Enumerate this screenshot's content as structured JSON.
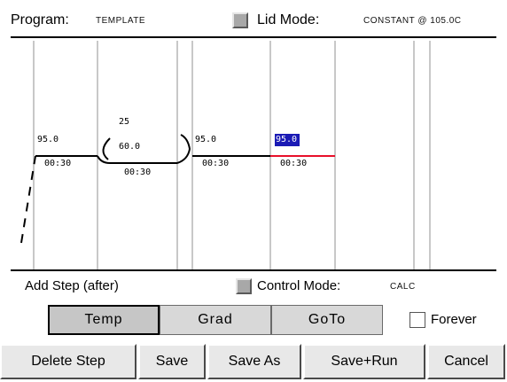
{
  "header": {
    "program_label": "Program:",
    "program_name": "TEMPLATE",
    "lid_mode_label": "Lid Mode:",
    "lid_mode_value": "CONSTANT @ 105.0C"
  },
  "steps": [
    {
      "temp": "95.0",
      "time": "00:30"
    },
    {
      "temp": "60.0",
      "time": "00:30",
      "goto": "25"
    },
    {
      "temp": "95.0",
      "time": "00:30"
    },
    {
      "temp": "95.0",
      "time": "00:30"
    }
  ],
  "controls": {
    "add_step_label": "Add Step (after)",
    "control_mode_label": "Control Mode:",
    "control_mode_value": "CALC",
    "tabs": [
      "Temp",
      "Grad",
      "GoTo"
    ],
    "active_tab": "Temp",
    "forever_label": "Forever"
  },
  "actions": [
    "Delete Step",
    "Save",
    "Save As",
    "Save+Run",
    "Cancel"
  ],
  "colors": {
    "selected_step_bg": "#1a1ab5",
    "selected_step_line": "#e8102a",
    "button_face": "#e8e8e8"
  }
}
